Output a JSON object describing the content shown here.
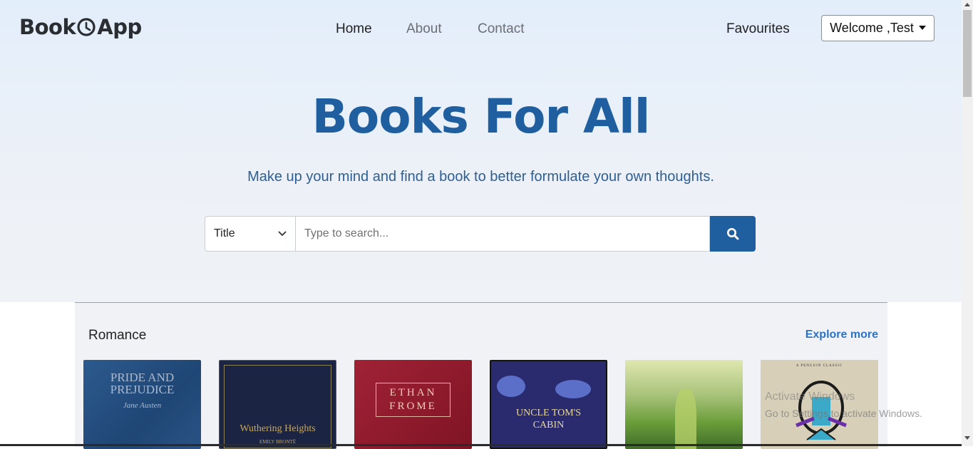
{
  "header": {
    "logo": {
      "part1": "Book",
      "part2": "App",
      "icon": "clock-icon"
    },
    "nav": [
      "Home",
      "About",
      "Contact"
    ],
    "favourites": "Favourites",
    "user_menu": "Welcome ,Test"
  },
  "hero": {
    "title": "Books For All",
    "subtitle": "Make up your mind and find a book to better formulate your own thoughts."
  },
  "search": {
    "select_value": "Title",
    "placeholder": "Type to search...",
    "button_icon": "search-icon"
  },
  "section": {
    "title": "Romance",
    "explore": "Explore more",
    "books": [
      {
        "cover_text": "PRIDE AND PREJUDICE",
        "author_text": "Jane Austen"
      },
      {
        "cover_text": "Wuthering Heights",
        "author_text": "EMILY BRONTË"
      },
      {
        "cover_text": "ETHAN FROME"
      },
      {
        "cover_text": "UNCLE TOM'S CABIN"
      },
      {},
      {
        "cover_text": "A PENGUIN CLASSIC"
      }
    ]
  },
  "os": {
    "watermark_line1": "Activate Windows",
    "watermark_line2": "Go to Settings to activate Windows."
  },
  "colors": {
    "brand": "#1f5fa0",
    "link": "#2c73c4"
  }
}
